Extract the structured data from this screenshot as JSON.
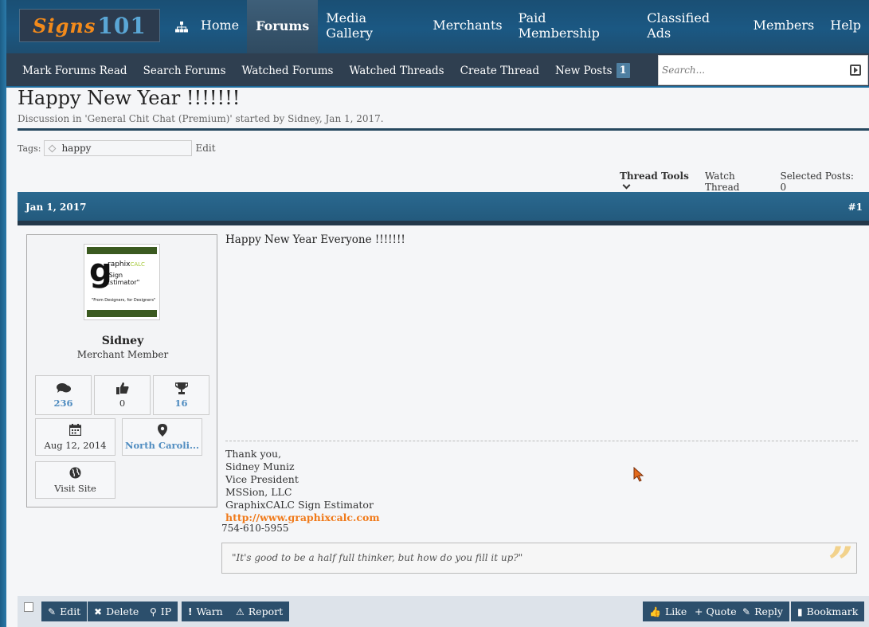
{
  "logo": {
    "text": "Signs",
    "num": "101"
  },
  "nav": {
    "items": [
      {
        "label": "Home"
      },
      {
        "label": "Forums"
      },
      {
        "label": "Media Gallery"
      },
      {
        "label": "Merchants"
      },
      {
        "label": "Paid Membership"
      },
      {
        "label": "Classified Ads"
      },
      {
        "label": "Members"
      },
      {
        "label": "Help"
      }
    ]
  },
  "subnav": {
    "items": [
      {
        "label": "Mark Forums Read"
      },
      {
        "label": "Search Forums"
      },
      {
        "label": "Watched Forums"
      },
      {
        "label": "Watched Threads"
      },
      {
        "label": "Create Thread"
      },
      {
        "label": "New Posts"
      }
    ],
    "new_posts_count": "1"
  },
  "search": {
    "placeholder": "Search..."
  },
  "thread": {
    "title": "Happy New Year !!!!!!!",
    "subtitle": "Discussion in 'General Chit Chat (Premium)' started by Sidney, Jan 1, 2017.",
    "tags_label": "Tags:",
    "tag": "happy",
    "tag_edit": "Edit",
    "tools": {
      "thread_tools": "Thread Tools",
      "watch": "Watch Thread",
      "selected": "Selected Posts: 0"
    }
  },
  "post": {
    "date": "Jan 1, 2017",
    "number": "#1",
    "message": "Happy New Year Everyone !!!!!!!",
    "user": {
      "name": "Sidney",
      "title": "Merchant Member",
      "avatar": {
        "brand": "raphix",
        "brand_c": "CALC",
        "estimator": "\"Sign Estimator\"",
        "tagline": "\"From Designers, for Designers\""
      },
      "stats": {
        "messages": "236",
        "likes": "0",
        "trophies": "16",
        "joined": "Aug 12, 2014",
        "location": "North Caroli...",
        "visit": "Visit Site"
      }
    },
    "signature": {
      "line1": "Thank you,",
      "line2": "Sidney Muniz",
      "line3": "Vice President",
      "line4": "MSSion, LLC",
      "line5": "GraphixCALC Sign Estimator",
      "link": "http://www.graphixcalc.com",
      "phone": "754-610-5955",
      "quote": "\"It's good to be a half full thinker, but how do you fill it up?\""
    }
  },
  "actions": {
    "edit": "Edit",
    "delete": "Delete",
    "ip": "IP",
    "warn": "Warn",
    "report": "Report",
    "like": "Like",
    "quote": "+ Quote",
    "reply": "Reply",
    "bookmark": "Bookmark"
  }
}
